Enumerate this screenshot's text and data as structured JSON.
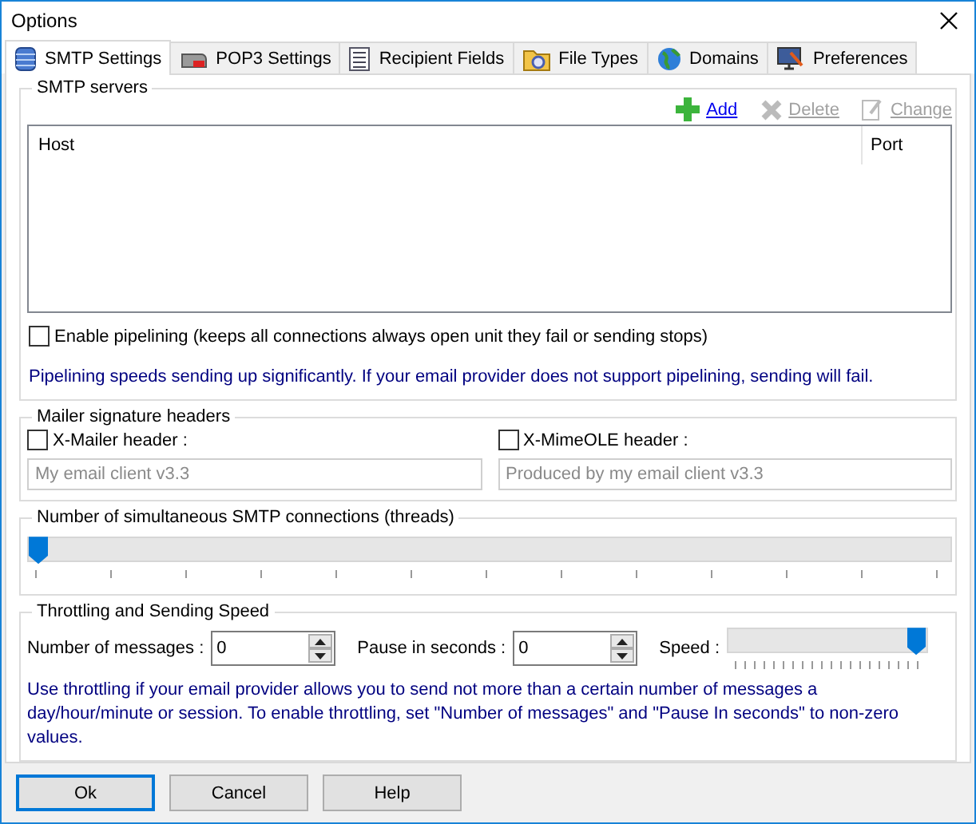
{
  "window": {
    "title": "Options"
  },
  "tabs": [
    {
      "label": "SMTP Settings",
      "selected": true
    },
    {
      "label": "POP3 Settings",
      "selected": false
    },
    {
      "label": "Recipient Fields",
      "selected": false
    },
    {
      "label": "File Types",
      "selected": false
    },
    {
      "label": "Domains",
      "selected": false
    },
    {
      "label": "Preferences",
      "selected": false
    }
  ],
  "smtp_servers": {
    "title": "SMTP servers",
    "actions": [
      {
        "label": "Add",
        "disabled": false
      },
      {
        "label": "Delete",
        "disabled": true
      },
      {
        "label": "Change",
        "disabled": true
      }
    ],
    "columns": [
      "Host",
      "Port"
    ],
    "pipelining": {
      "label": "Enable pipelining (keeps all connections always open unit they fail or sending stops)",
      "checked": false
    },
    "note": "Pipelining speeds sending up significantly. If your email provider does not support pipelining, sending will fail."
  },
  "mailer_headers": {
    "title": "Mailer signature headers",
    "fields": [
      {
        "label": "X-Mailer header :",
        "checked": false,
        "placeholder": "My email client v3.3"
      },
      {
        "label": "X-MimeOLE header :",
        "checked": false,
        "placeholder": "Produced by my email client v3.3"
      }
    ]
  },
  "threads": {
    "title": "Number of simultaneous SMTP connections (threads)",
    "level": 0
  },
  "throttling": {
    "title": "Throttling and Sending Speed",
    "messages": {
      "label": "Number of messages :",
      "value": "0"
    },
    "pause": {
      "label": "Pause in seconds :",
      "value": "0"
    },
    "speed": {
      "label": "Speed :",
      "level": 1
    },
    "note": "Use throttling if your email provider allows you to send not more than a certain number of messages a day/hour/minute or session. To enable throttling, set \"Number of messages\" and \"Pause In seconds\" to non-zero values."
  },
  "buttons": [
    {
      "label": "Ok",
      "selected": true
    },
    {
      "label": "Cancel",
      "selected": false
    },
    {
      "label": "Help",
      "selected": false
    }
  ]
}
